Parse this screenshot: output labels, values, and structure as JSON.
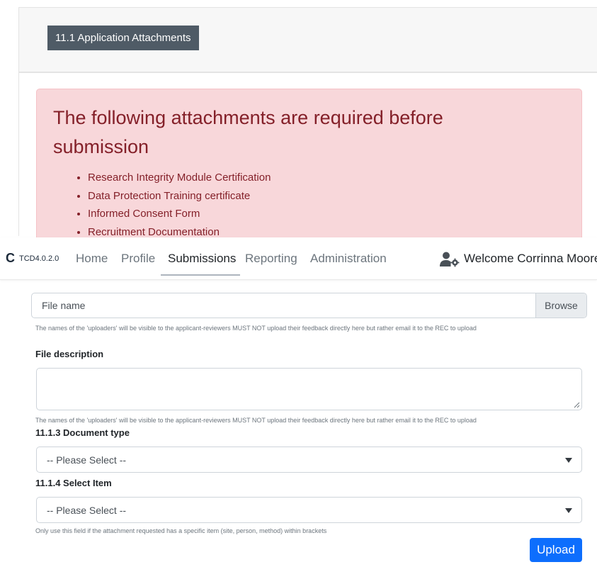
{
  "section": {
    "heading": "11.1 Application Attachments"
  },
  "alert": {
    "title": "The following attachments are required before submission",
    "items": [
      "Research Integrity Module Certification",
      "Data Protection Training certificate",
      "Informed Consent Form",
      "Recruitment Documentation"
    ],
    "colors": {
      "background": "#f8d7da",
      "text": "#842029"
    }
  },
  "navbar": {
    "brand_letter": "C",
    "version": "TCD4.0.2.0",
    "links": [
      "Home",
      "Profile",
      "Submissions",
      "Reporting",
      "Administration"
    ],
    "active_link": "Submissions",
    "welcome": "Welcome Corrinna Moore",
    "user_icon": "user-settings-icon"
  },
  "form": {
    "file_placeholder": "File name",
    "browse_label": "Browse",
    "file_help": "The names of the 'uploaders' will be visible to the applicant-reviewers MUST NOT upload their feedback directly here but rather email it to the REC to upload",
    "description_label": "File description",
    "description_value": "",
    "description_help": "The names of the 'uploaders' will be visible to the applicant-reviewers MUST NOT upload their feedback directly here but rather email it to the REC to upload",
    "document_type_label": "11.1.3 Document type",
    "document_type_value": "-- Please Select --",
    "select_item_label": "11.1.4 Select Item",
    "select_item_value": "-- Please Select --",
    "select_item_help": "Only use this field if the attachment requested has a specific item (site, person, method) within brackets",
    "upload_label": "Upload",
    "primary_color": "#0d6efd"
  }
}
